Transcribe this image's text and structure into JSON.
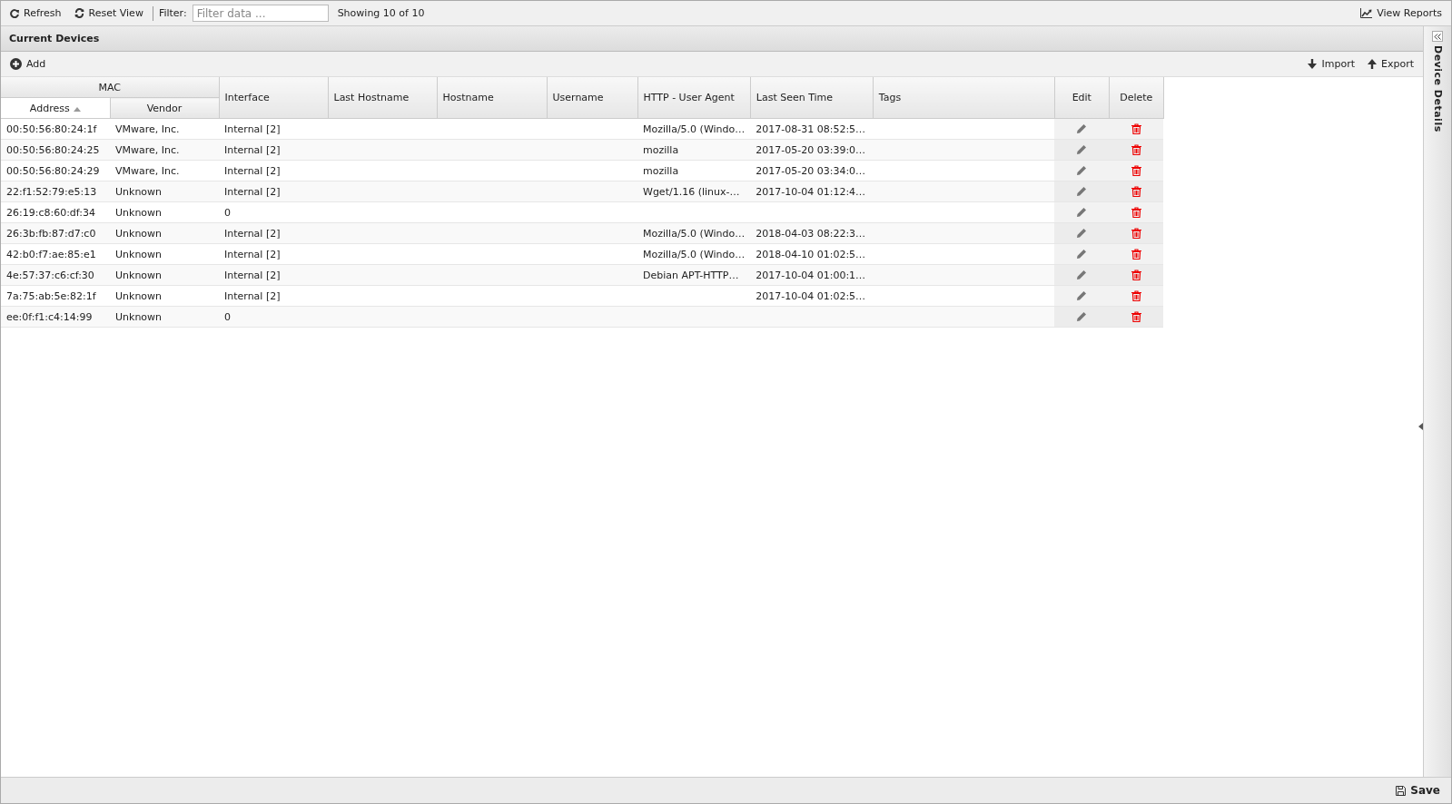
{
  "toolbar": {
    "refresh": "Refresh",
    "reset_view": "Reset View",
    "filter_label": "Filter:",
    "filter": {
      "placeholder": "Filter data ..."
    },
    "count": "Showing 10 of 10",
    "view_reports": "View Reports"
  },
  "panel": {
    "title": "Current Devices",
    "add": "Add",
    "import": "Import",
    "export": "Export"
  },
  "table": {
    "group": "MAC",
    "columns": [
      {
        "label": "Address",
        "sorted": true
      },
      {
        "label": "Vendor",
        "sorted": false
      },
      {
        "label": "Interface",
        "sorted": false
      },
      {
        "label": "Last Hostname",
        "sorted": false
      },
      {
        "label": "Hostname",
        "sorted": false
      },
      {
        "label": "Username",
        "sorted": false
      },
      {
        "label": "HTTP - User Agent",
        "sorted": false
      },
      {
        "label": "Last Seen Time",
        "sorted": false
      },
      {
        "label": "Tags",
        "sorted": false
      },
      {
        "label": "Edit",
        "sorted": false
      },
      {
        "label": "Delete",
        "sorted": false
      }
    ],
    "rows": [
      [
        "00:50:56:80:24:1f",
        "VMware, Inc.",
        "Internal [2]",
        "",
        "",
        "",
        "Mozilla/5.0 (Windo…",
        "2017-08-31 08:52:5…",
        ""
      ],
      [
        "00:50:56:80:24:25",
        "VMware, Inc.",
        "Internal [2]",
        "",
        "",
        "",
        "mozilla",
        "2017-05-20 03:39:0…",
        ""
      ],
      [
        "00:50:56:80:24:29",
        "VMware, Inc.",
        "Internal [2]",
        "",
        "",
        "",
        "mozilla",
        "2017-05-20 03:34:0…",
        ""
      ],
      [
        "22:f1:52:79:e5:13",
        "Unknown",
        "Internal [2]",
        "",
        "",
        "",
        "Wget/1.16 (linux-…",
        "2017-10-04 01:12:4…",
        ""
      ],
      [
        "26:19:c8:60:df:34",
        "Unknown",
        "0",
        "",
        "",
        "",
        "",
        "",
        ""
      ],
      [
        "26:3b:fb:87:d7:c0",
        "Unknown",
        "Internal [2]",
        "",
        "",
        "",
        "Mozilla/5.0 (Windo…",
        "2018-04-03 08:22:3…",
        ""
      ],
      [
        "42:b0:f7:ae:85:e1",
        "Unknown",
        "Internal [2]",
        "",
        "",
        "",
        "Mozilla/5.0 (Windo…",
        "2018-04-10 01:02:5…",
        ""
      ],
      [
        "4e:57:37:c6:cf:30",
        "Unknown",
        "Internal [2]",
        "",
        "",
        "",
        "Debian APT-HTTP…",
        "2017-10-04 01:00:1…",
        ""
      ],
      [
        "7a:75:ab:5e:82:1f",
        "Unknown",
        "Internal [2]",
        "",
        "",
        "",
        "",
        "2017-10-04 01:02:5…",
        ""
      ],
      [
        "ee:0f:f1:c4:14:99",
        "Unknown",
        "0",
        "",
        "",
        "",
        "",
        "",
        ""
      ]
    ]
  },
  "side_panel": {
    "title": "Device Details"
  },
  "footer": {
    "save": "Save"
  }
}
